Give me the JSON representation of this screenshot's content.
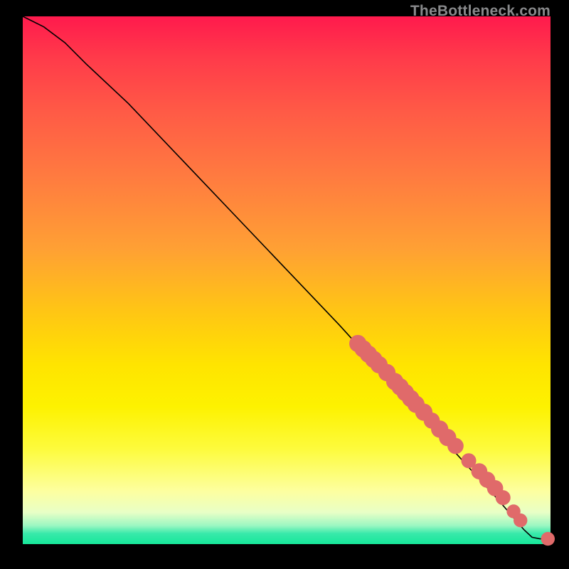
{
  "watermark": "TheBottleneck.com",
  "colors": {
    "curve": "#000000",
    "point_fill": "#e06a6a",
    "point_stroke": "#d85f5f"
  },
  "chart_data": {
    "type": "line",
    "title": "",
    "xlabel": "",
    "ylabel": "",
    "xlim": [
      0,
      100
    ],
    "ylim": [
      0,
      100
    ],
    "curve": [
      {
        "x": 0,
        "y": 100
      },
      {
        "x": 4,
        "y": 98
      },
      {
        "x": 8,
        "y": 95
      },
      {
        "x": 12,
        "y": 91
      },
      {
        "x": 20,
        "y": 83.5
      },
      {
        "x": 30,
        "y": 73
      },
      {
        "x": 40,
        "y": 62.5
      },
      {
        "x": 50,
        "y": 52
      },
      {
        "x": 60,
        "y": 41.5
      },
      {
        "x": 65,
        "y": 36
      },
      {
        "x": 70,
        "y": 30.5
      },
      {
        "x": 75,
        "y": 25
      },
      {
        "x": 80,
        "y": 19.5
      },
      {
        "x": 85,
        "y": 14
      },
      {
        "x": 90,
        "y": 8.5
      },
      {
        "x": 93,
        "y": 5
      },
      {
        "x": 95,
        "y": 2.7
      },
      {
        "x": 96.5,
        "y": 1.3
      },
      {
        "x": 98,
        "y": 1.0
      },
      {
        "x": 100,
        "y": 1.0
      }
    ],
    "points": [
      {
        "x": 63.5,
        "y": 38.0,
        "r": 2.0
      },
      {
        "x": 64.5,
        "y": 37.0,
        "r": 2.0
      },
      {
        "x": 65.5,
        "y": 36.0,
        "r": 2.0
      },
      {
        "x": 66.5,
        "y": 35.0,
        "r": 2.0
      },
      {
        "x": 67.5,
        "y": 34.0,
        "r": 2.0
      },
      {
        "x": 69.0,
        "y": 32.5,
        "r": 2.0
      },
      {
        "x": 70.5,
        "y": 30.8,
        "r": 2.0
      },
      {
        "x": 71.5,
        "y": 29.8,
        "r": 2.0
      },
      {
        "x": 72.5,
        "y": 28.7,
        "r": 2.0
      },
      {
        "x": 73.5,
        "y": 27.6,
        "r": 2.0
      },
      {
        "x": 74.5,
        "y": 26.5,
        "r": 2.0
      },
      {
        "x": 76.0,
        "y": 25.0,
        "r": 2.0
      },
      {
        "x": 77.5,
        "y": 23.4,
        "r": 1.8
      },
      {
        "x": 79.0,
        "y": 21.8,
        "r": 2.0
      },
      {
        "x": 80.5,
        "y": 20.2,
        "r": 2.0
      },
      {
        "x": 82.0,
        "y": 18.6,
        "r": 1.8
      },
      {
        "x": 84.5,
        "y": 15.8,
        "r": 1.6
      },
      {
        "x": 86.5,
        "y": 13.8,
        "r": 1.8
      },
      {
        "x": 88.0,
        "y": 12.2,
        "r": 1.8
      },
      {
        "x": 89.5,
        "y": 10.6,
        "r": 1.8
      },
      {
        "x": 91.0,
        "y": 8.8,
        "r": 1.6
      },
      {
        "x": 93.0,
        "y": 6.2,
        "r": 1.4
      },
      {
        "x": 94.3,
        "y": 4.5,
        "r": 1.4
      },
      {
        "x": 99.5,
        "y": 1.0,
        "r": 1.4
      }
    ]
  }
}
